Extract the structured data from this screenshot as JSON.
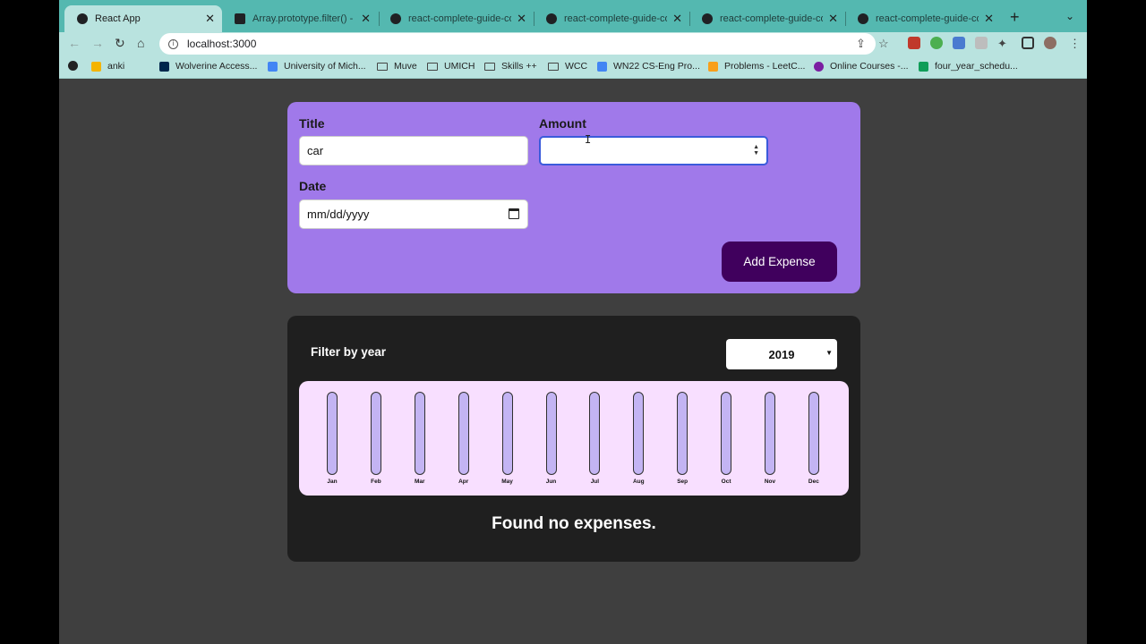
{
  "browser": {
    "tabs": [
      {
        "label": "React App",
        "active": true
      },
      {
        "label": "Array.prototype.filter() - Ja"
      },
      {
        "label": "react-complete-guide-cod"
      },
      {
        "label": "react-complete-guide-cod"
      },
      {
        "label": "react-complete-guide-cod"
      },
      {
        "label": "react-complete-guide-cod"
      }
    ],
    "url": "localhost:3000",
    "bookmarks": [
      "anki",
      "Wolverine Access...",
      "University of Mich...",
      "Muve",
      "UMICH",
      "Skills ++",
      "WCC",
      "WN22 CS-Eng Pro...",
      "Problems - LeetC...",
      "Online Courses -...",
      "four_year_schedu..."
    ]
  },
  "form": {
    "title_label": "Title",
    "title_value": "car",
    "amount_label": "Amount",
    "amount_value": "",
    "date_label": "Date",
    "date_placeholder": "mm/dd/yyyy",
    "submit_label": "Add Expense"
  },
  "filter": {
    "label": "Filter by year",
    "selected_year": "2019"
  },
  "chart_data": {
    "type": "bar",
    "categories": [
      "Jan",
      "Feb",
      "Mar",
      "Apr",
      "May",
      "Jun",
      "Jul",
      "Aug",
      "Sep",
      "Oct",
      "Nov",
      "Dec"
    ],
    "values": [
      0,
      0,
      0,
      0,
      0,
      0,
      0,
      0,
      0,
      0,
      0,
      0
    ]
  },
  "list": {
    "empty_message": "Found no expenses."
  },
  "colors": {
    "form_bg": "#a079ea",
    "button_bg": "#40005d",
    "chart_bg": "#f8dfff",
    "bar_fill": "#4826b9"
  }
}
